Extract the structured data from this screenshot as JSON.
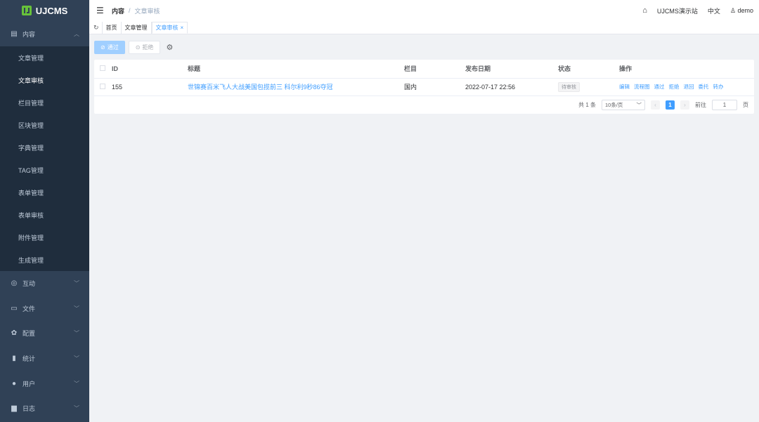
{
  "app": {
    "logo_text": "UJCMS"
  },
  "sidebar": {
    "content_group": {
      "label": "内容",
      "icon": "document-icon"
    },
    "content_items": [
      {
        "label": "文章管理"
      },
      {
        "label": "文章审核"
      },
      {
        "label": "栏目管理"
      },
      {
        "label": "区块管理"
      },
      {
        "label": "字典管理"
      },
      {
        "label": "TAG管理"
      },
      {
        "label": "表单管理"
      },
      {
        "label": "表单审核"
      },
      {
        "label": "附件管理"
      },
      {
        "label": "生成管理"
      }
    ],
    "groups": [
      {
        "label": "互动",
        "icon": "chat-icon"
      },
      {
        "label": "文件",
        "icon": "folder-icon"
      },
      {
        "label": "配置",
        "icon": "gear-icon"
      },
      {
        "label": "统计",
        "icon": "bar-chart-icon"
      },
      {
        "label": "用户",
        "icon": "user-icon"
      },
      {
        "label": "日志",
        "icon": "log-icon"
      }
    ]
  },
  "topbar": {
    "breadcrumb_root": "内容",
    "breadcrumb_sep": "/",
    "breadcrumb_current": "文章审核",
    "site_name": "UJCMS演示站",
    "language": "中文",
    "username": "demo"
  },
  "tags": [
    {
      "label": "首页"
    },
    {
      "label": "文章管理"
    },
    {
      "label": "文章审核"
    }
  ],
  "toolbar": {
    "pass_label": "通过",
    "reject_label": "拒绝"
  },
  "table": {
    "headers": {
      "id": "ID",
      "title": "标题",
      "channel": "栏目",
      "date": "发布日期",
      "status": "状态",
      "ops": "操作"
    },
    "rows": [
      {
        "id": "155",
        "title": "世锦赛百米飞人大战美国包揽前三 科尔利9秒86夺冠",
        "channel": "国内",
        "date": "2022-07-17 22:56",
        "status": "待审核",
        "ops": [
          "编辑",
          "流程图",
          "通过",
          "拒绝",
          "退回",
          "委托",
          "转办"
        ]
      }
    ]
  },
  "pagination": {
    "total_text": "共 1 条",
    "page_size": "10条/页",
    "current_page": "1",
    "goto_label": "前往",
    "goto_value": "1",
    "page_suffix": "页"
  }
}
